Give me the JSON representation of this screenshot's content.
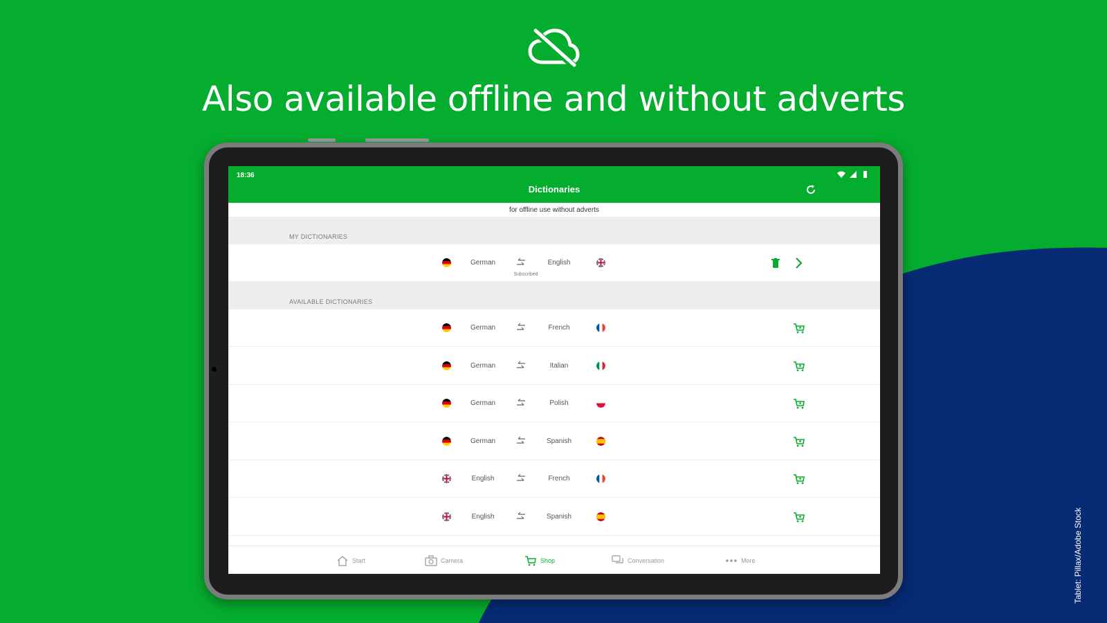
{
  "promo": {
    "icon": "cloud-off-icon",
    "headline": "Also available offline and without adverts",
    "credit": "Tablet: Pillax/Adobe Stock"
  },
  "colors": {
    "green": "#05ad2e",
    "navy": "#062a73",
    "white": "#ffffff"
  },
  "status_bar": {
    "time": "18:36"
  },
  "app": {
    "title": "Dictionaries",
    "subtitle": "for offline use without adverts",
    "refresh_icon": "refresh-icon"
  },
  "my_dictionaries": {
    "header": "MY DICTIONARIES",
    "items": [
      {
        "from": "German",
        "to": "English",
        "note": "Subscribed",
        "from_flag": "de",
        "to_flag": "gb"
      }
    ]
  },
  "available_dictionaries": {
    "header": "AVAILABLE DICTIONARIES",
    "items": [
      {
        "from": "German",
        "to": "French",
        "from_flag": "de",
        "to_flag": "fr"
      },
      {
        "from": "German",
        "to": "Italian",
        "from_flag": "de",
        "to_flag": "it"
      },
      {
        "from": "German",
        "to": "Polish",
        "from_flag": "de",
        "to_flag": "pl"
      },
      {
        "from": "German",
        "to": "Spanish",
        "from_flag": "de",
        "to_flag": "es"
      },
      {
        "from": "English",
        "to": "French",
        "from_flag": "gb",
        "to_flag": "fr"
      },
      {
        "from": "English",
        "to": "Spanish",
        "from_flag": "gb",
        "to_flag": "es"
      }
    ]
  },
  "bottom_nav": [
    {
      "label": "Start",
      "icon": "home-icon",
      "active": false
    },
    {
      "label": "Camera",
      "icon": "camera-icon",
      "active": false
    },
    {
      "label": "Shop",
      "icon": "cart-icon",
      "active": true
    },
    {
      "label": "Conversation",
      "icon": "chat-icon",
      "active": false
    },
    {
      "label": "More",
      "icon": "more-icon",
      "active": false
    }
  ]
}
